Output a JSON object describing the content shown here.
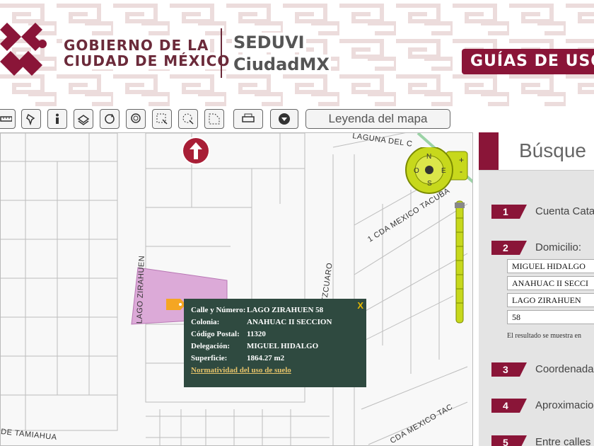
{
  "header": {
    "gov_line1": "GOBIERNO DE LA",
    "gov_line2": "CIUDAD DE MÉXICO",
    "agency_line1": "SEDUVI",
    "agency_line2": "CiudadMX",
    "guides_button": "GUÍAS DE USO",
    "brand_color": "#8a1538"
  },
  "toolbar": {
    "tools": [
      "measure-icon",
      "pin-icon",
      "info-icon",
      "layers-icon",
      "refresh-icon",
      "zoom-circle-icon",
      "select-rect-icon",
      "select-circle-icon",
      "select-polygon-icon",
      "print-icon",
      "download-icon"
    ],
    "legend_label": "Leyenda del mapa"
  },
  "map": {
    "streets": {
      "laguna": "LAGUNA DEL C",
      "cda_mexico": "1 CDA MEXICO TACUBA",
      "lago_zirahuen": "LAGO ZIRAHUEN",
      "lago_patzcuaro": "LAGO PATZCUARO",
      "tamiahua": "DE TAMIAHUA",
      "cda_mexico2": "CDA MEXICO TAC"
    },
    "compass": {
      "n": "N",
      "s": "S",
      "e": "E",
      "o": "O"
    },
    "popup": {
      "close": "X",
      "rows": [
        {
          "label": "Calle y Número:",
          "value": "LAGO ZIRAHUEN 58"
        },
        {
          "label": "Colonia:",
          "value": "ANAHUAC II SECCION"
        },
        {
          "label": "Código Postal:",
          "value": "11320"
        },
        {
          "label": "Delegación:",
          "value": "MIGUEL HIDALGO"
        },
        {
          "label": "Superficie:",
          "value": "1864.27 m2"
        }
      ],
      "link": "Normatividad del uso de suelo"
    },
    "parcel_color": "#dcaad8",
    "popup_bg": "#2f4a40"
  },
  "panel": {
    "title": "Búsque",
    "steps": [
      {
        "num": "1",
        "label": "Cuenta Cata"
      },
      {
        "num": "2",
        "label": "Domicilio:"
      },
      {
        "num": "3",
        "label": "Coordenada"
      },
      {
        "num": "4",
        "label": "Aproximacio"
      },
      {
        "num": "5",
        "label": "Entre calles"
      }
    ],
    "fields": [
      "MIGUEL HIDALGO",
      "ANAHUAC II SECCI",
      "LAGO ZIRAHUEN",
      "58"
    ],
    "result_note": "El resultado se muestra en"
  }
}
